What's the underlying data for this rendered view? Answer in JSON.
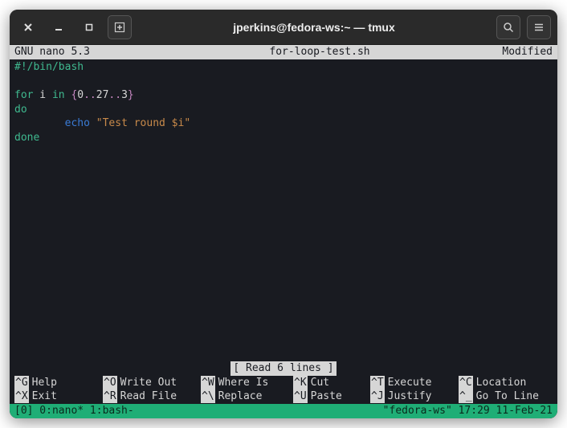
{
  "window": {
    "title": "jperkins@fedora-ws:~ — tmux"
  },
  "nano": {
    "app": "GNU nano 5.3",
    "filename": "for-loop-test.sh",
    "modified": "Modified",
    "status": "[ Read 6 lines ]",
    "code": {
      "l1": "#!/bin/bash",
      "l2_for": "for",
      "l2_i": " i ",
      "l2_in": "in ",
      "l2_brace_open": "{",
      "l2_a": "0",
      "l2_d1": "..",
      "l2_b": "27",
      "l2_d2": "..",
      "l2_c": "3",
      "l2_brace_close": "}",
      "l3": "do",
      "l4_indent": "        ",
      "l4_echo": "echo ",
      "l4_str": "\"Test round $i\"",
      "l5": "done"
    },
    "shortcuts": {
      "r1": [
        {
          "k": "^G",
          "l": "Help"
        },
        {
          "k": "^O",
          "l": "Write Out"
        },
        {
          "k": "^W",
          "l": "Where Is"
        },
        {
          "k": "^K",
          "l": "Cut"
        },
        {
          "k": "^T",
          "l": "Execute"
        },
        {
          "k": "^C",
          "l": "Location"
        }
      ],
      "r2": [
        {
          "k": "^X",
          "l": "Exit"
        },
        {
          "k": "^R",
          "l": "Read File"
        },
        {
          "k": "^\\",
          "l": "Replace"
        },
        {
          "k": "^U",
          "l": "Paste"
        },
        {
          "k": "^J",
          "l": "Justify"
        },
        {
          "k": "^_",
          "l": "Go To Line"
        }
      ]
    }
  },
  "tmux": {
    "left": "[0] 0:nano* 1:bash-",
    "right": "\"fedora-ws\" 17:29 11-Feb-21"
  }
}
